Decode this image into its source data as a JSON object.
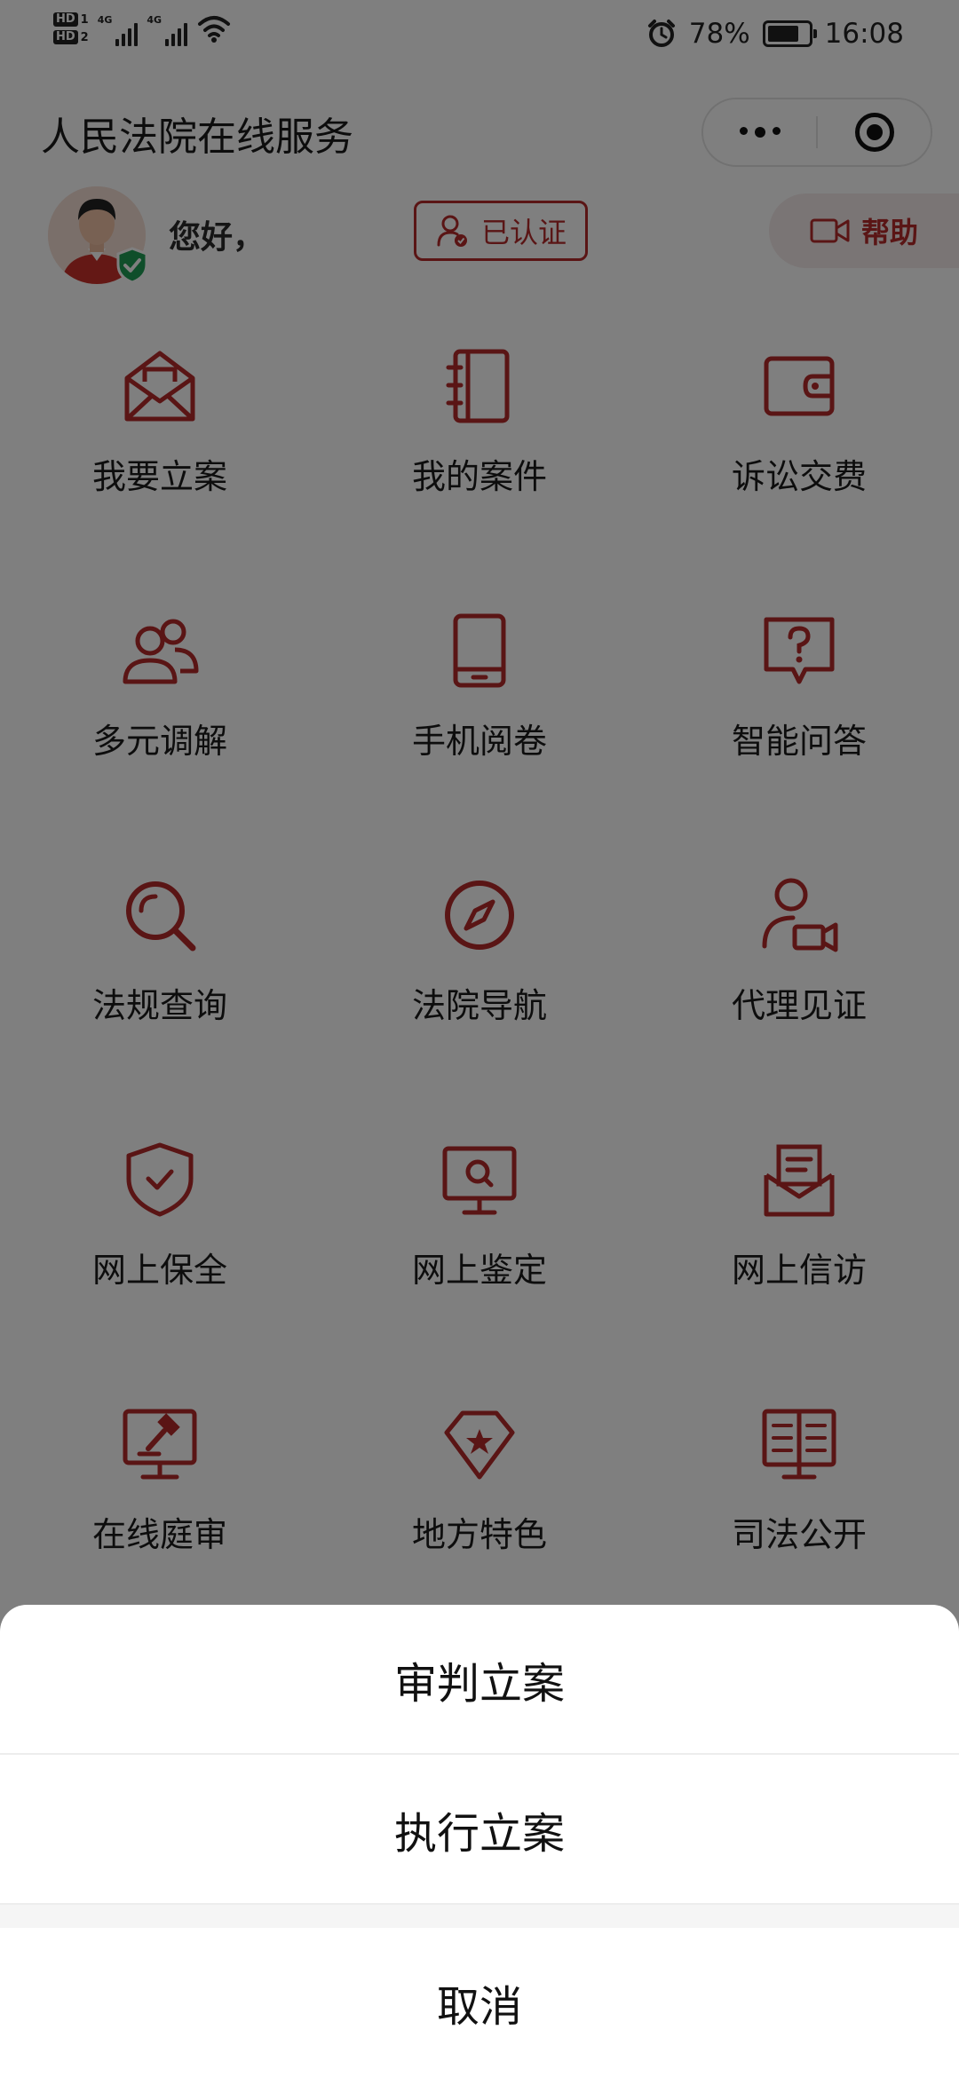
{
  "status_bar": {
    "sim1": "HD",
    "sim1_num": "1",
    "sim2": "HD",
    "sim2_num": "2",
    "network1": "4G",
    "network2": "4G",
    "battery_percent": "78%",
    "battery_level": 0.78,
    "time": "16:08",
    "icons": [
      "alarm-icon",
      "wifi-icon",
      "battery-icon"
    ]
  },
  "header": {
    "title": "人民法院在线服务",
    "menu_icon": "more-dots-icon",
    "close_icon": "target-icon"
  },
  "user": {
    "greeting": "您好，",
    "verified_label": "已认证",
    "help_label": "帮助"
  },
  "services": [
    {
      "label": "我要立案",
      "icon": "envelope-icon"
    },
    {
      "label": "我的案件",
      "icon": "notebook-icon"
    },
    {
      "label": "诉讼交费",
      "icon": "wallet-icon"
    },
    {
      "label": "多元调解",
      "icon": "people-icon"
    },
    {
      "label": "手机阅卷",
      "icon": "tablet-icon"
    },
    {
      "label": "智能问答",
      "icon": "question-icon"
    },
    {
      "label": "法规查询",
      "icon": "search-icon"
    },
    {
      "label": "法院导航",
      "icon": "compass-icon"
    },
    {
      "label": "代理见证",
      "icon": "user-video-icon"
    },
    {
      "label": "网上保全",
      "icon": "shield-check-icon"
    },
    {
      "label": "网上鉴定",
      "icon": "monitor-search-icon"
    },
    {
      "label": "网上信访",
      "icon": "mail-doc-icon"
    },
    {
      "label": "在线庭审",
      "icon": "gavel-monitor-icon"
    },
    {
      "label": "地方特色",
      "icon": "star-badge-icon"
    },
    {
      "label": "司法公开",
      "icon": "book-board-icon"
    }
  ],
  "action_sheet": {
    "options": [
      "审判立案",
      "执行立案"
    ],
    "cancel": "取消"
  },
  "colors": {
    "accent": "#b52a2a",
    "overlay": "rgba(0,0,0,0.5)"
  }
}
